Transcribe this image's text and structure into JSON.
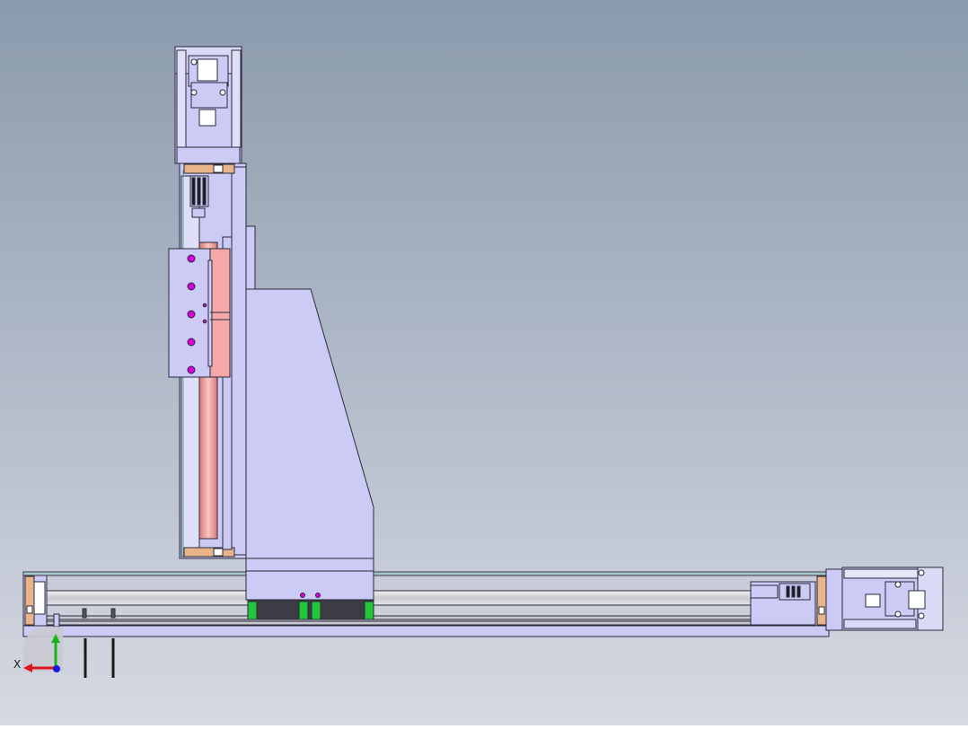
{
  "view": {
    "background_top": "#8a9aac",
    "background_bottom": "#d6d9e3",
    "part_fill": "#cbcbf5",
    "part_fill_dark": "#b8b8ea",
    "outline": "#2a2a3a",
    "screw_color": "#f4a9a6",
    "bearing_color": "#e8b48a",
    "slider_green": "#22c63a",
    "bolt_magenta": "#d800d8",
    "rail_gray": "#d8d8dc"
  },
  "triad": {
    "x_label": "X",
    "x_color": "#e0141e",
    "y_color": "#18b418",
    "z_color": "#1818e0"
  }
}
